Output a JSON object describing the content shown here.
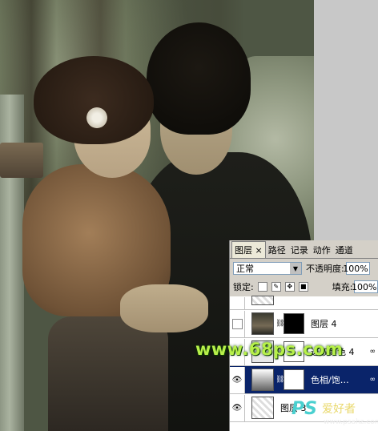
{
  "watermark": "www.68ps.com",
  "site_logo": {
    "mark": "PS",
    "name": "爱好者",
    "url": "www.psahz.com"
  },
  "layers_panel": {
    "tabs": [
      {
        "label": "图层",
        "close": "×"
      },
      {
        "label": "路径"
      },
      {
        "label": "记录"
      },
      {
        "label": "动作"
      },
      {
        "label": "通道"
      }
    ],
    "blend_mode": "正常",
    "opacity_label": "不透明度:",
    "opacity_value": "100%",
    "lock_label": "锁定:",
    "fill_label": "填充:",
    "fill_value": "100%",
    "layers": [
      {
        "name": "",
        "visible": false,
        "selected": false
      },
      {
        "name": "图层 4",
        "visible": false,
        "selected": false,
        "thumb": "photo",
        "mask": "black"
      },
      {
        "name": "选取颜色 4",
        "visible": false,
        "selected": false,
        "thumb": "adjustment",
        "mask": "white",
        "link": "∞"
      },
      {
        "name": "色相/饱…",
        "visible": true,
        "selected": true,
        "thumb": "gradient",
        "mask": "white",
        "link": "∞"
      },
      {
        "name": "图层 3",
        "visible": true,
        "selected": false,
        "thumb": "checker"
      }
    ]
  }
}
